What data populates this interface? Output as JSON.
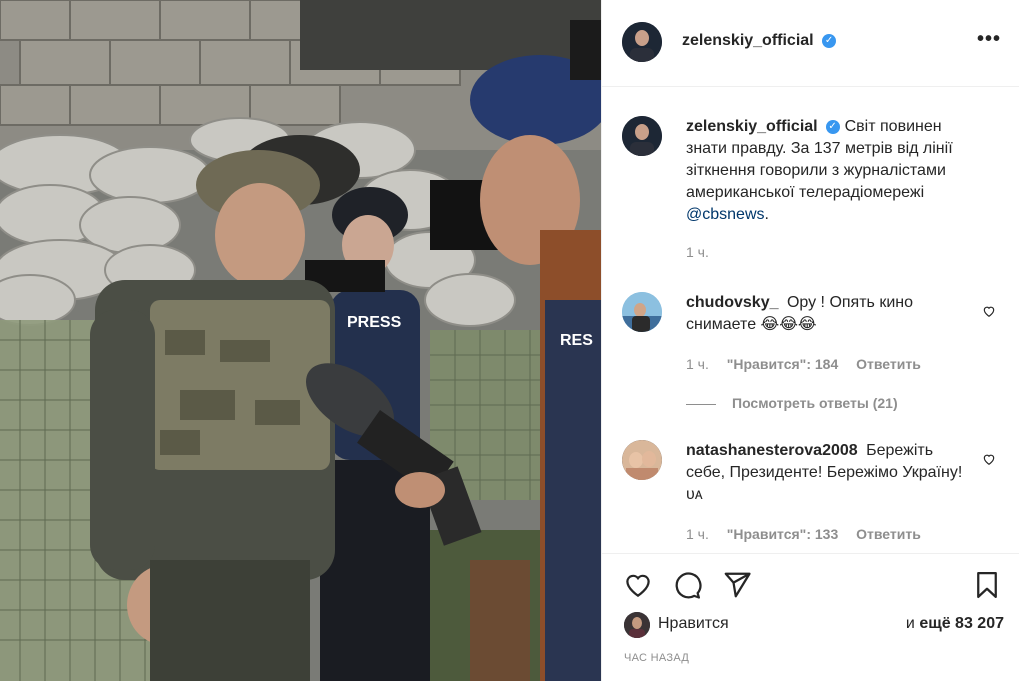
{
  "header": {
    "username": "zelenskiy_official",
    "more_label": "•••"
  },
  "caption": {
    "username": "zelenskiy_official",
    "text": "Світ повинен знати правду. За 137 метрів від лінії зіткнення говорили з журналістами американської телерадіомережі",
    "mention": "@cbsnews",
    "after_mention": ".",
    "time": "1 ч."
  },
  "comments": [
    {
      "username": "chudovsky_",
      "text": "Ору ! Опять кино снимаете 😂😂😂",
      "time": "1 ч.",
      "likes": "\"Нравится\": 184",
      "reply_label": "Ответить"
    },
    {
      "username": "natashanesterova2008",
      "text": "Бережіть себе, Президенте! Бережімо Україну!ᴜᴀ",
      "time": "1 ч.",
      "likes": "\"Нравится\": 133",
      "reply_label": "Ответить"
    }
  ],
  "view_replies_label": "Посмотреть ответы (21)",
  "actions": {
    "icons": [
      "heart-icon",
      "comment-icon",
      "share-icon",
      "bookmark-icon"
    ]
  },
  "likes": {
    "label": "Нравится",
    "prefix": "и",
    "count": "ещё 83 207"
  },
  "timestamp": "ЧАС НАЗАД",
  "colors": {
    "verified": "#3897f0",
    "secondary_text": "#8e8e8e",
    "mention": "#00376b",
    "divider": "#efefef"
  }
}
